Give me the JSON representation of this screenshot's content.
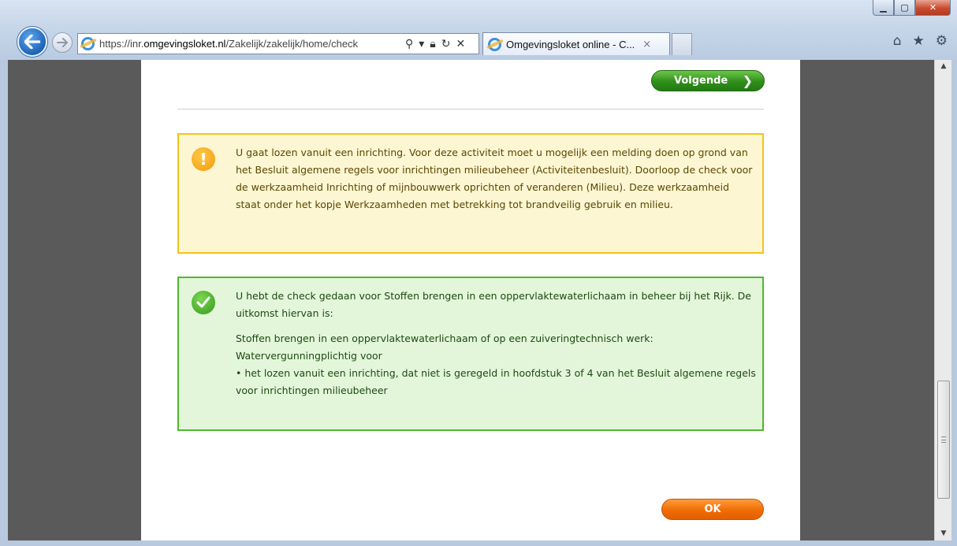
{
  "browser": {
    "url_prefix": "https://inr.",
    "url_domain": "omgevingsloket.nl",
    "url_rest": "/Zakelijk/zakelijk/home/check",
    "tab_title": "Omgevingsloket online - C...",
    "tab_close": "×"
  },
  "dialog": {
    "next_button": "Volgende",
    "ok_button": "OK",
    "warning": {
      "text": "U gaat lozen vanuit een inrichting. Voor deze activiteit moet u mogelijk een melding doen op grond van het Besluit algemene regels voor inrichtingen milieubeheer (Activiteitenbesluit). Doorloop de check voor de werkzaamheid Inrichting of mijnbouwwerk oprichten of veranderen (Milieu). Deze werkzaamheid staat onder het kopje Werkzaamheden met betrekking tot brandveilig gebruik en milieu."
    },
    "result": {
      "intro": "U hebt de check gedaan voor Stoffen brengen in een oppervlaktewaterlichaam in beheer bij het Rijk. De uitkomst hiervan is:",
      "line1": "Stoffen brengen in een oppervlaktewaterlichaam of op een zuiveringtechnisch werk:",
      "line2": "Watervergunningplichtig voor",
      "bullet": "•  het lozen vanuit een inrichting, dat niet is geregeld in hoofdstuk 3 of 4 van het Besluit algemene regels voor inrichtingen milieubeheer"
    }
  },
  "colors": {
    "warning_border": "#f2c31c",
    "warning_bg": "#fdf6d3",
    "success_border": "#4fb830",
    "success_bg": "#e3f6da",
    "next_button": "#2f8f1a",
    "ok_button": "#f06d05"
  },
  "icons": {
    "back": "arrow-left-icon",
    "forward": "arrow-right-icon",
    "warning": "exclamation-icon",
    "success": "checkmark-icon"
  }
}
